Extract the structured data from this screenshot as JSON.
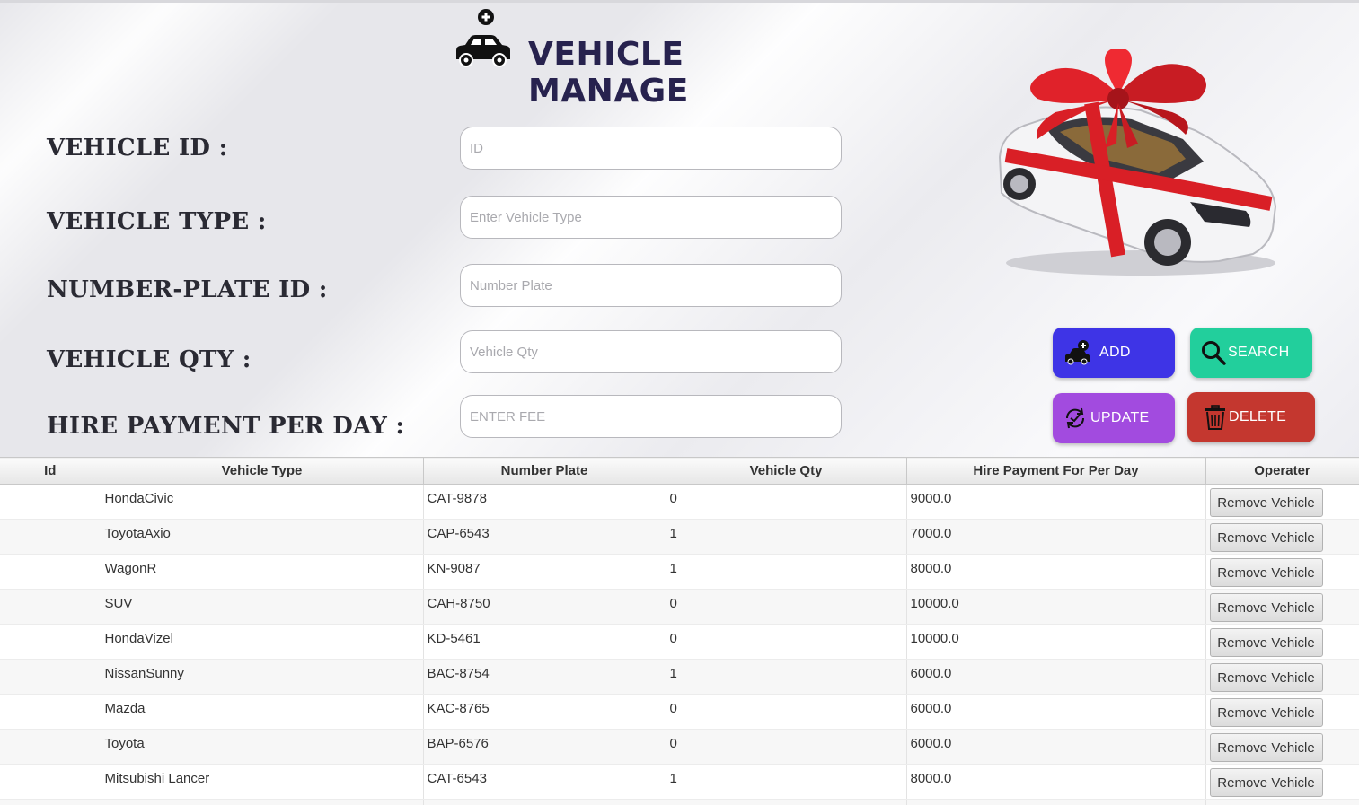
{
  "header": {
    "title": "VEHICLE MANAGE"
  },
  "form": {
    "vehicle_id": {
      "label": "VEHICLE ID :",
      "placeholder": "ID",
      "value": ""
    },
    "vehicle_type": {
      "label": "VEHICLE TYPE :",
      "placeholder": "Enter Vehicle Type",
      "value": ""
    },
    "number_plate": {
      "label": "NUMBER-PLATE ID :",
      "placeholder": "Number Plate",
      "value": ""
    },
    "vehicle_qty": {
      "label": "VEHICLE QTY :",
      "placeholder": "Vehicle Qty",
      "value": ""
    },
    "hire_payment": {
      "label": "HIRE PAYMENT PER DAY :",
      "placeholder": "ENTER FEE",
      "value": ""
    }
  },
  "actions": {
    "add": "ADD",
    "search": "SEARCH",
    "update": "UPDATE",
    "delete": "DELETE"
  },
  "table": {
    "columns": [
      "Id",
      "Vehicle Type",
      "Number Plate",
      "Vehicle Qty",
      "Hire Payment For Per Day",
      "Operater"
    ],
    "rows": [
      {
        "id": "",
        "type": "HondaCivic",
        "plate": "CAT-9878",
        "qty": "0",
        "fee": "9000.0",
        "op": "Remove Vehicle"
      },
      {
        "id": "",
        "type": "ToyotaAxio",
        "plate": "CAP-6543",
        "qty": "1",
        "fee": "7000.0",
        "op": "Remove Vehicle"
      },
      {
        "id": "",
        "type": "WagonR",
        "plate": "KN-9087",
        "qty": "1",
        "fee": "8000.0",
        "op": "Remove Vehicle"
      },
      {
        "id": "",
        "type": "SUV",
        "plate": "CAH-8750",
        "qty": "0",
        "fee": "10000.0",
        "op": "Remove Vehicle"
      },
      {
        "id": "",
        "type": "HondaVizel",
        "plate": "KD-5461",
        "qty": "0",
        "fee": "10000.0",
        "op": "Remove Vehicle"
      },
      {
        "id": "",
        "type": "NissanSunny",
        "plate": "BAC-8754",
        "qty": "1",
        "fee": "6000.0",
        "op": "Remove Vehicle"
      },
      {
        "id": "",
        "type": "Mazda",
        "plate": "KAC-8765",
        "qty": "0",
        "fee": "6000.0",
        "op": "Remove Vehicle"
      },
      {
        "id": "",
        "type": "Toyota",
        "plate": "BAP-6576",
        "qty": "0",
        "fee": "6000.0",
        "op": "Remove Vehicle"
      },
      {
        "id": "",
        "type": "Mitsubishi Lancer",
        "plate": "CAT-6543",
        "qty": "1",
        "fee": "8000.0",
        "op": "Remove Vehicle"
      },
      {
        "id": "",
        "type": "",
        "plate": "",
        "qty": "",
        "fee": "",
        "op": ""
      }
    ]
  },
  "colors": {
    "title": "#27224e",
    "add": "#3e34e6",
    "search": "#22cf9c",
    "update": "#a24bdf",
    "delete": "#c4372f",
    "ribbon": "#d91f26"
  },
  "icons": {
    "header": "car-add-icon",
    "add": "car-add-icon",
    "search": "search-icon",
    "update": "refresh-check-icon",
    "delete": "trash-icon"
  }
}
